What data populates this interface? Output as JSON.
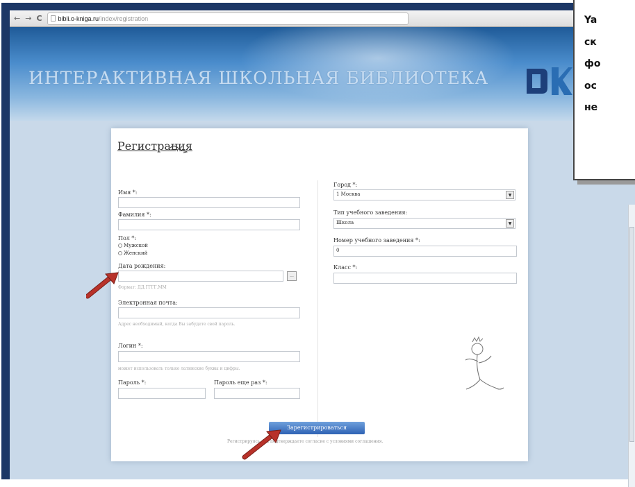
{
  "browser": {
    "back_icon": "back-arrow-icon",
    "forward_icon": "forward-arrow-icon",
    "reload_icon": "reload-icon",
    "url_domain": "bibli.o-kniga.ru",
    "url_path": "/index/registration"
  },
  "site": {
    "title": "ИНТЕРАКТИВНАЯ ШКОЛЬНАЯ БИБЛИОТЕКА"
  },
  "form": {
    "title": "Регистрация",
    "first_name_label": "Имя *:",
    "last_name_label": "Фамилия *:",
    "gender_label": "Пол *:",
    "gender_options": [
      "Мужской",
      "Женский"
    ],
    "birthdate_label": "Дата рождения:",
    "birthdate_hint": "Формат: ДД.ГГГГ.ММ",
    "email_label": "Электронная почта:",
    "email_hint": "Адрес необходимый, когда Вы забудете свой пароль.",
    "login_label": "Логин *:",
    "login_hint": "может использовать только латинские буквы и цифры.",
    "password_label": "Пароль *:",
    "password_repeat_label": "Пароль еще раз *:",
    "city_label": "Город *:",
    "city_value": "1 Москва",
    "school_type_label": "Тип учебного заведения:",
    "school_type_value": "Школа",
    "school_number_label": "Номер учебного заведения *:",
    "school_number_value": "0",
    "class_label": "Класс *:",
    "submit_label": "Зарегистрироваться",
    "footnote": "Регистрируясь, Вы подтверждаете согласие с условиями соглашения."
  },
  "note": {
    "lines": [
      "Ya",
      "ск",
      "фо",
      "ос",
      "не"
    ]
  },
  "colors": {
    "frame": "#1c3766",
    "header_dark": "#1f5b98",
    "page_bg": "#c9d9e9",
    "button": "#2e62b4",
    "arrow": "#b8322a"
  }
}
